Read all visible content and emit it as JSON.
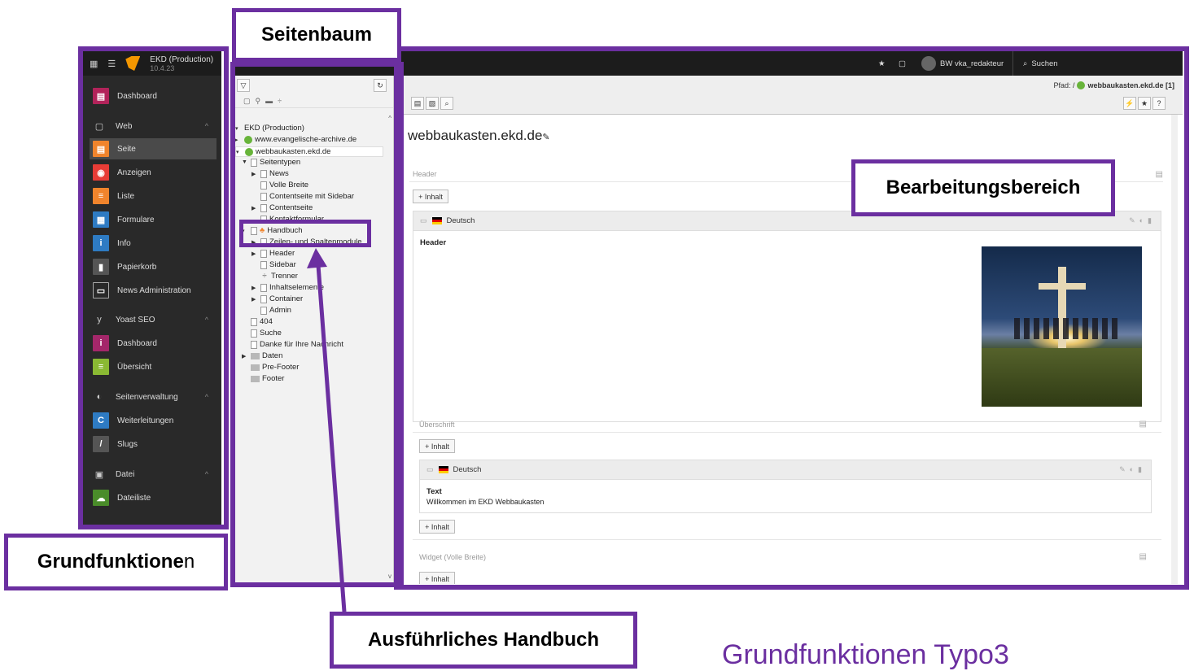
{
  "modmenu": {
    "site_name": "EKD (Production)",
    "site_version": "10.4.23",
    "items": [
      {
        "label": "Dashboard",
        "icon": "dashboard-icon",
        "color": "#b2235a"
      },
      {
        "label": "Web",
        "icon": "page-icon",
        "group": true
      },
      {
        "label": "Seite",
        "icon": "page-module-icon",
        "color": "#f0842c"
      },
      {
        "label": "Anzeigen",
        "icon": "eye-icon",
        "color": "#e73c36"
      },
      {
        "label": "Liste",
        "icon": "list-icon",
        "color": "#f0842c"
      },
      {
        "label": "Formulare",
        "icon": "form-icon",
        "color": "#2e7bc3"
      },
      {
        "label": "Info",
        "icon": "info-icon",
        "color": "#2e7bc3"
      },
      {
        "label": "Papierkorb",
        "icon": "trash-icon",
        "color": "#555555"
      },
      {
        "label": "News Administration",
        "icon": "news-icon"
      },
      {
        "label": "Yoast SEO",
        "icon": "yoast-icon",
        "group": true
      },
      {
        "label": "Dashboard",
        "icon": "info-icon",
        "color": "#a4276a"
      },
      {
        "label": "Übersicht",
        "icon": "overview-icon",
        "color": "#8ab933"
      },
      {
        "label": "Seitenverwaltung",
        "icon": "globe-icon",
        "group": true
      },
      {
        "label": "Weiterleitungen",
        "icon": "redirect-icon",
        "color": "#2e7bc3"
      },
      {
        "label": "Slugs",
        "icon": "slug-icon",
        "color": "#555555"
      },
      {
        "label": "Datei",
        "icon": "file-icon",
        "group": true
      },
      {
        "label": "Dateiliste",
        "icon": "filelist-icon",
        "color": "#4a8c2a"
      }
    ]
  },
  "tree": {
    "nodes": [
      {
        "label": "EKD (Production)",
        "type": "root"
      },
      {
        "label": "www.evangelische-archive.de",
        "type": "site"
      },
      {
        "label": "webbaukasten.ekd.de",
        "type": "site"
      },
      {
        "label": "Seitentypen",
        "type": "page"
      },
      {
        "label": "News",
        "type": "page"
      },
      {
        "label": "Volle Breite",
        "type": "page"
      },
      {
        "label": "Contentseite mit Sidebar",
        "type": "page"
      },
      {
        "label": "Contentseite",
        "type": "page"
      },
      {
        "label": "Kontaktformular",
        "type": "page"
      },
      {
        "label": "Handbuch",
        "type": "page"
      },
      {
        "label": "Zeilen- und Spaltenmodule",
        "type": "page"
      },
      {
        "label": "Header",
        "type": "page"
      },
      {
        "label": "Sidebar",
        "type": "page"
      },
      {
        "label": "Trenner",
        "type": "separator"
      },
      {
        "label": "Inhaltselemente",
        "type": "page"
      },
      {
        "label": "Container",
        "type": "page"
      },
      {
        "label": "Admin",
        "type": "page"
      },
      {
        "label": "404",
        "type": "page"
      },
      {
        "label": "Suche",
        "type": "page"
      },
      {
        "label": "Danke für Ihre Nachricht",
        "type": "page"
      },
      {
        "label": "Daten",
        "type": "folder"
      },
      {
        "label": "Pre-Footer",
        "type": "folder"
      },
      {
        "label": "Footer",
        "type": "folder"
      }
    ]
  },
  "topbar": {
    "user": "BW vka_redakteur",
    "search": "Suchen"
  },
  "docheader": {
    "path_label": "Pfad: /",
    "path_site": "webbaukasten.ekd.de [1]"
  },
  "content": {
    "page_title": "webbaukasten.ekd.de",
    "col_header": "Header",
    "add_content": "+ Inhalt",
    "language": "Deutsch",
    "header_element_title": "Header",
    "col_ueberschrift": "Überschrift",
    "text_element_title": "Text",
    "text_element_body": "Willkommen im  EKD Webbaukasten",
    "col_widget": "Widget (Volle Breite)"
  },
  "annotations": {
    "seitenbaum": "Seitenbaum",
    "bearbeitungsbereich": "Bearbeitungsbereich",
    "grundfunktionen_bold": "Grundfunktione",
    "grundfunktionen_normal": "n",
    "handbuch": "Ausführliches Handbuch",
    "slide_title": "Grundfunktionen Typo3"
  },
  "colors": {
    "accent": "#6b2fa0",
    "dark": "#1c1c1c"
  }
}
